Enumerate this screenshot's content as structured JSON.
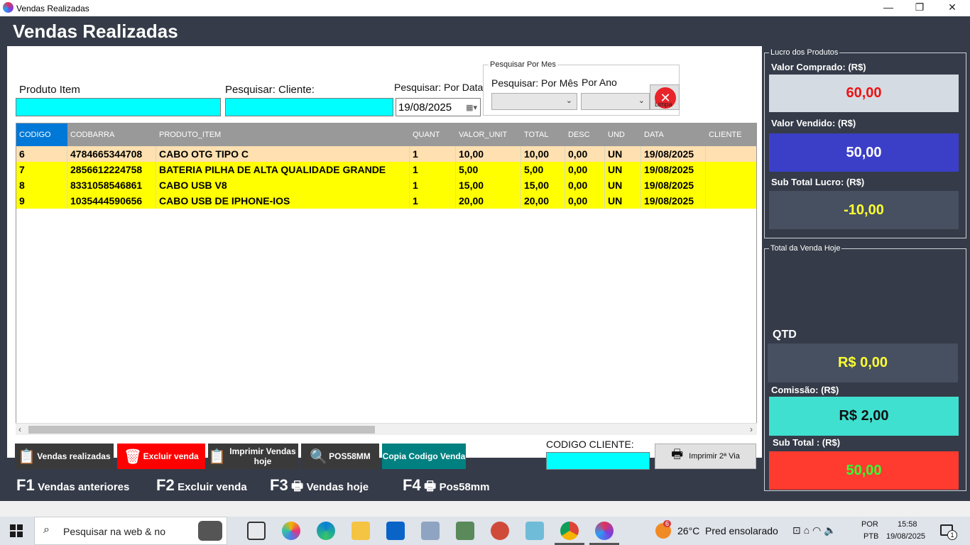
{
  "window": {
    "title": "Vendas Realizadas",
    "minimize": "—",
    "restore": "❐",
    "close": "✕"
  },
  "page_title": "Vendas Realizadas",
  "filters": {
    "produto_label": "Produto Item",
    "cliente_label": "Pesquisar: Cliente:",
    "data_label": "Pesquisar: Por Data",
    "data_value": "19/08/2025",
    "mes_group_title": "Pesquisar Por Mes",
    "mes_label": "Pesquisar: Por Mês",
    "ano_label": "Por Ano",
    "limpa_label": "Limpa"
  },
  "grid": {
    "columns": [
      "CODIGO",
      "CODBARRA",
      "PRODUTO_ITEM",
      "QUANT",
      "VALOR_UNIT",
      "TOTAL",
      "DESC",
      "UND",
      "DATA",
      "CLIENTE"
    ],
    "rows": [
      [
        "6",
        "4784665344708",
        "CABO OTG TIPO C",
        "1",
        "10,00",
        "10,00",
        "0,00",
        "UN",
        "19/08/2025",
        ""
      ],
      [
        "7",
        "2856612224758",
        "BATERIA PILHA DE ALTA QUALIDADE GRANDE",
        "1",
        "5,00",
        "5,00",
        "0,00",
        "UN",
        "19/08/2025",
        ""
      ],
      [
        "8",
        "8331058546861",
        "CABO USB V8",
        "1",
        "15,00",
        "15,00",
        "0,00",
        "UN",
        "19/08/2025",
        ""
      ],
      [
        "9",
        "1035444590656",
        "CABO USB DE IPHONE-IOS",
        "1",
        "20,00",
        "20,00",
        "0,00",
        "UN",
        "19/08/2025",
        ""
      ]
    ],
    "selected_row_color": "#ffe0b0",
    "row_color": "#ffff00"
  },
  "buttons": {
    "vendas_realizadas": "Vendas realizadas",
    "excluir_venda": "Excluir venda",
    "imprimir_vendas_hoje": "Imprimir Vendas hoje",
    "pos58mm": "POS58MM",
    "copia_codigo_venda": "Copia Codigo Venda",
    "codigo_cliente_label": "CODIGO CLIENTE:",
    "imprimir_2via": "Imprimir 2ª Via"
  },
  "shortcuts": {
    "f1_key": "F1",
    "f1_label": "Vendas anteriores",
    "f2_key": "F2",
    "f2_label": "Excluir venda",
    "f3_key": "F3",
    "f3_label": "Vendas hoje",
    "f4_key": "F4",
    "f4_label": "Pos58mm"
  },
  "lucro": {
    "title": "Lucro dos Produtos",
    "comprado_label": "Valor Comprado: (R$)",
    "comprado_value": "60,00",
    "vendido_label": "Valor Vendido: (R$)",
    "vendido_value": "50,00",
    "subtotal_label": "Sub Total Lucro: (R$)",
    "subtotal_value": "-10,00"
  },
  "total_hoje": {
    "title": "Total da Venda Hoje",
    "qtd_label": "QTD",
    "qtd_value": "R$ 0,00",
    "comissao_label": "Comissão: (R$)",
    "comissao_value": "R$ 2,00",
    "subtotal_label": "Sub Total : (R$)",
    "subtotal_value": "50,00"
  },
  "colors": {
    "background": "#353b48",
    "input_cyan": "#00ffff",
    "excluir_red": "#ff0000",
    "dark_button": "#3a3a3a",
    "teal_button": "#008080",
    "comprado_bg": "#d5dbe3",
    "vendido_bg": "#3b3fc8",
    "lucro_bg": "#465060",
    "comissao_bg": "#40e0d0",
    "subtotal_bg": "#ff3b30"
  },
  "taskbar": {
    "search_placeholder": "Pesquisar na web & no",
    "weather": "26°C  Pred ensolarado",
    "weather_badge": "6",
    "lang_top": "POR",
    "lang_bottom": "PTB",
    "time": "15:58",
    "date": "19/08/2025",
    "notif_count": "1"
  }
}
